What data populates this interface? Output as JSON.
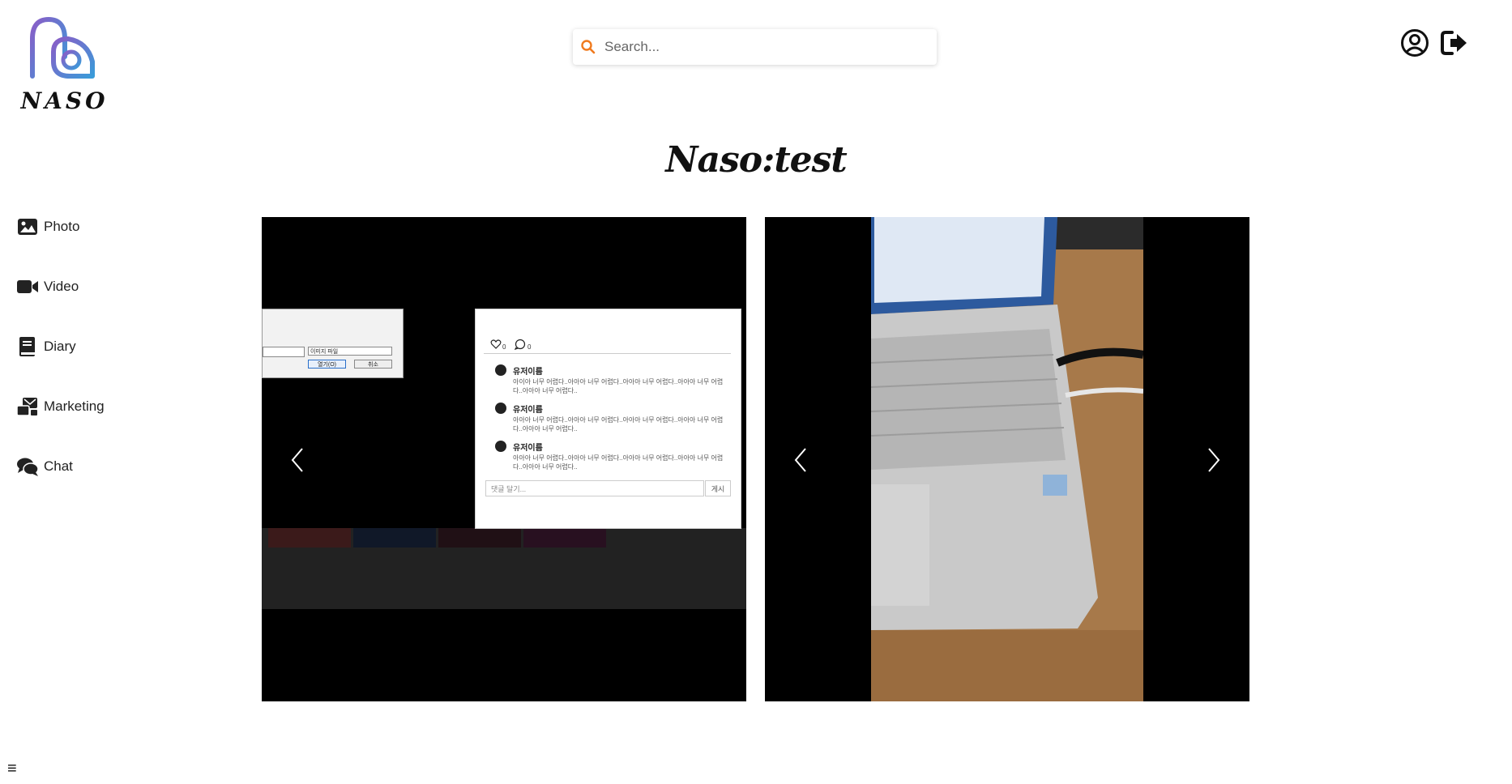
{
  "logo": {
    "text": "NASO"
  },
  "search": {
    "placeholder": "Search..."
  },
  "header": {
    "profile_icon": "user-circle-icon",
    "logout_icon": "sign-out-icon"
  },
  "page": {
    "title": "Naso:test"
  },
  "sidebar": {
    "items": [
      {
        "label": "Photo",
        "icon": "image-icon"
      },
      {
        "label": "Video",
        "icon": "video-camera-icon"
      },
      {
        "label": "Diary",
        "icon": "book-icon"
      },
      {
        "label": "Marketing",
        "icon": "mail-bulk-icon"
      },
      {
        "label": "Chat",
        "icon": "comments-icon"
      }
    ],
    "menu_toggle": "≡"
  },
  "carousel_left": {
    "likes": "0",
    "comments_count": "0",
    "comments": [
      {
        "user": "유저이름",
        "text": "아이아 너무 어렵다..아아아 너무 어렵다..아아아 너무 어렵다..아아아 너무 어렵다..아아아 너무 어렵다.."
      },
      {
        "user": "유저이름",
        "text": "아아아 너무 어렵다..아아아 너무 어렵다..아아아 너무 어렵다..아아아 너무 어렵다..아아아 너무 어렵다.."
      },
      {
        "user": "유저이름",
        "text": "아아아 너무 어렵다..아아아 너무 어렵다..아아아 너무 어렵다..아아아 너무 어렵다..아아아 너무 어렵다.."
      }
    ],
    "comment_placeholder": "댓글 달기...",
    "post_label": "게시",
    "dialog_filetype": "이미지 파일",
    "dialog_open": "열기(O)",
    "dialog_cancel": "취소"
  },
  "colors": {
    "accent": "#f07a1e",
    "logo_gradient_start": "#8a5cc7",
    "logo_gradient_end": "#3a9bd9"
  }
}
